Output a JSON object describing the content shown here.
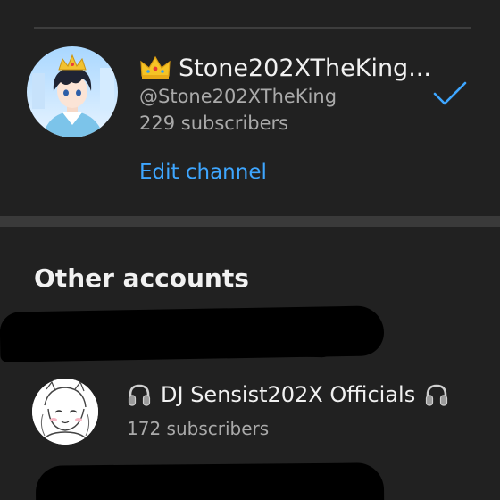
{
  "current_account": {
    "name": "Stone202XTheKing...",
    "handle": "@Stone202XTheKing",
    "subscribers": "229 subscribers",
    "edit_label": "Edit channel",
    "crown_icon": "crown-icon",
    "check_icon": "checkmark-icon"
  },
  "other_accounts": {
    "heading": "Other accounts",
    "accounts": [
      {
        "name": "DJ Sensist202X Officials",
        "subscribers": "172 subscribers",
        "icon": "headphones-icon"
      }
    ]
  },
  "colors": {
    "background": "#212121",
    "primary_text": "#f1f1f1",
    "secondary_text": "#aaaaaa",
    "accent": "#3ea6ff",
    "divider": "#3a3a3a"
  }
}
